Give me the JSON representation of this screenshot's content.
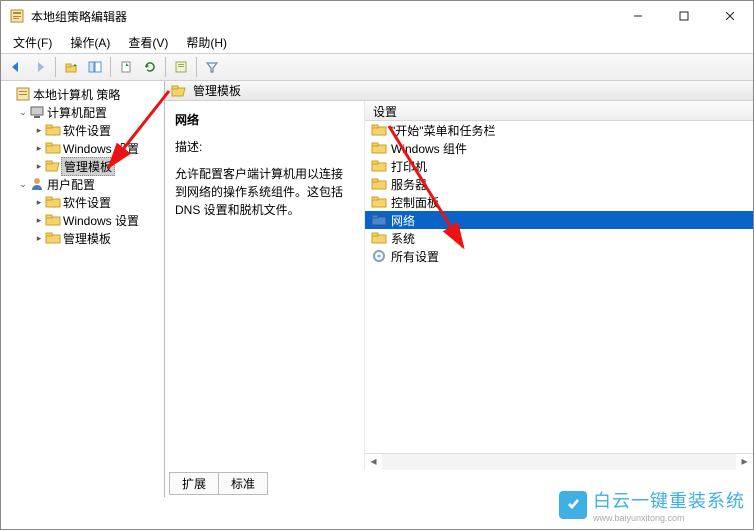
{
  "window": {
    "title": "本地组策略编辑器"
  },
  "menu": {
    "file": "文件(F)",
    "action": "操作(A)",
    "view": "查看(V)",
    "help": "帮助(H)"
  },
  "tree": {
    "root": "本地计算机 策略",
    "computer": "计算机配置",
    "c_soft": "软件设置",
    "c_win": "Windows 设置",
    "c_admin": "管理模板",
    "user": "用户配置",
    "u_soft": "软件设置",
    "u_win": "Windows 设置",
    "u_admin": "管理模板"
  },
  "header": {
    "title": "管理模板"
  },
  "desc": {
    "title": "网络",
    "label_desc": "描述:",
    "text": "允许配置客户端计算机用以连接到网络的操作系统组件。这包括 DNS 设置和脱机文件。"
  },
  "list": {
    "header": "设置",
    "items": [
      {
        "label": "\"开始\"菜单和任务栏"
      },
      {
        "label": "Windows 组件"
      },
      {
        "label": "打印机"
      },
      {
        "label": "服务器"
      },
      {
        "label": "控制面板"
      },
      {
        "label": "网络"
      },
      {
        "label": "系统"
      },
      {
        "label": "所有设置"
      }
    ],
    "selected_index": 5
  },
  "tabs": {
    "extended": "扩展",
    "standard": "标准"
  },
  "watermark": {
    "text": "白云一键重装系统",
    "url": "www.baiyunxitong.com"
  }
}
